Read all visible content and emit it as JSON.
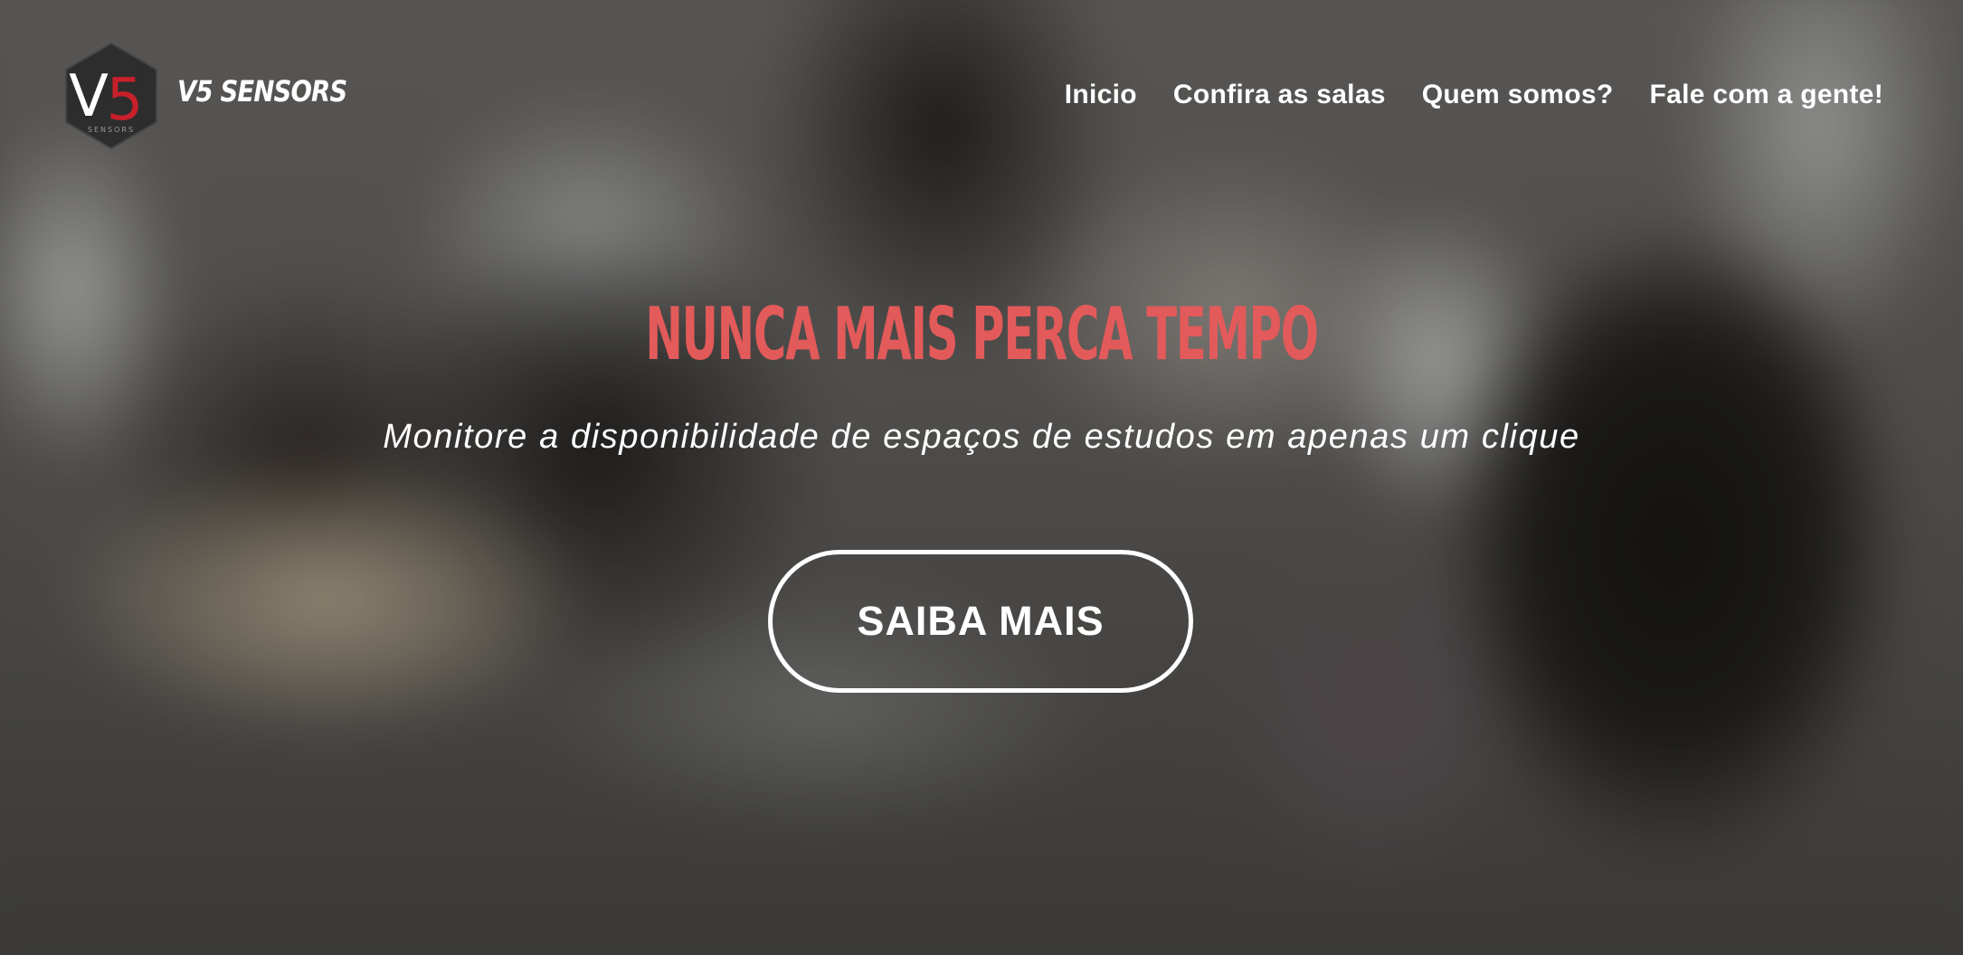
{
  "header": {
    "logo": {
      "icon": "v5-hexagon-logo-icon",
      "mark_text": "V5",
      "sub_text": "SENSORS"
    },
    "brand_name": "V5 SENSORS",
    "nav": [
      {
        "label": "Inicio"
      },
      {
        "label": "Confira as salas"
      },
      {
        "label": "Quem somos?"
      },
      {
        "label": "Fale com a gente!"
      }
    ]
  },
  "hero": {
    "headline": "NUNCA MAIS PERCA TEMPO",
    "subtitle": "Monitore a disponibilidade de espaços de estudos em apenas um clique",
    "cta_label": "SAIBA MAIS"
  },
  "colors": {
    "headline": "#e35a5a",
    "text": "#ffffff",
    "logo_red": "#c8202a",
    "logo_hex": "#2e2d2d"
  }
}
